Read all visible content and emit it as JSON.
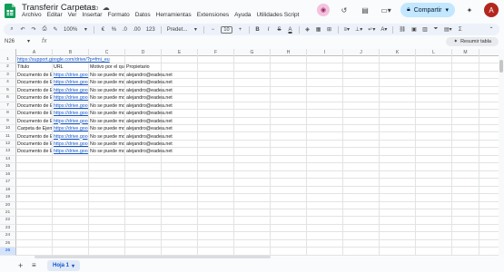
{
  "doc": {
    "title": "Transferir Carpetas",
    "star_icon": "star-icon",
    "move_icon": "folder-move-icon",
    "cloud_icon": "cloud-saved-icon"
  },
  "menu": [
    "Archivo",
    "Editar",
    "Ver",
    "Insertar",
    "Formato",
    "Datos",
    "Herramientas",
    "Extensiones",
    "Ayuda",
    "Utilidades Script"
  ],
  "actions": {
    "share_label": "Compartir",
    "avatar_letter": "A",
    "brand_color": "#0f9d58",
    "share_bg": "#c2e7ff"
  },
  "toolbar": {
    "zoom": "100%",
    "currency": "€",
    "percent": "%",
    "dec_dec": ".0",
    "dec_inc": ".00",
    "number_format": "123",
    "font": "Predet...",
    "font_size": "10",
    "bold": "B",
    "italic": "I",
    "strike": "S",
    "textcolor": "A"
  },
  "formula": {
    "namebox": "N26",
    "fx": "fx",
    "value": ""
  },
  "summary_button": "Resumir tabla",
  "columns": [
    "A",
    "B",
    "C",
    "D",
    "E",
    "F",
    "G",
    "H",
    "I",
    "J",
    "K",
    "L",
    "M"
  ],
  "rows": [
    "1",
    "2",
    "3",
    "4",
    "5",
    "6",
    "7",
    "8",
    "9",
    "10",
    "11",
    "12",
    "13",
    "14",
    "15",
    "16",
    "17",
    "18",
    "19",
    "20",
    "21",
    "22",
    "23",
    "24",
    "25",
    "26"
  ],
  "cells": {
    "r1_a": "https://support.google.com/drive/?p=fmi_eu",
    "header": [
      "Título",
      "URL",
      "Motivo por el que",
      "Propietario"
    ],
    "data": [
      [
        "Documento de E",
        "https://drive.goog",
        "No se puede mo",
        "alejandro@eadea.net"
      ],
      [
        "Documento de E",
        "https://drive.goog",
        "No se puede mo",
        "alejandro@eadea.net"
      ],
      [
        "Documento de E",
        "https://drive.goog",
        "No se puede mo",
        "alejandro@eadea.net"
      ],
      [
        "Documento de E",
        "https://drive.goog",
        "No se puede mo",
        "alejandro@eadea.net"
      ],
      [
        "Documento de E",
        "https://drive.goog",
        "No se puede mo",
        "alejandro@eadea.net"
      ],
      [
        "Documento de E",
        "https://drive.goog",
        "No se puede mo",
        "alejandro@eadea.net"
      ],
      [
        "Documento de E",
        "https://drive.goog",
        "No se puede mo",
        "alejandro@eadea.net"
      ],
      [
        "Carpeta de Ejem",
        "https://drive.goog",
        "No se puede mo",
        "alejandro@eadea.net"
      ],
      [
        "Documento de E",
        "https://drive.goog",
        "No se puede mo",
        "alejandro@eadea.net"
      ],
      [
        "Documento de E",
        "https://drive.goog",
        "No se puede mo",
        "alejandro@eadea.net"
      ],
      [
        "Documento de E",
        "https://drive.goog",
        "No se puede mo",
        "alejandro@eadea.net"
      ]
    ]
  },
  "selected_row": "26",
  "sheet": {
    "tab_label": "Hoja 1",
    "add_label": "+",
    "all_label": "≡"
  }
}
